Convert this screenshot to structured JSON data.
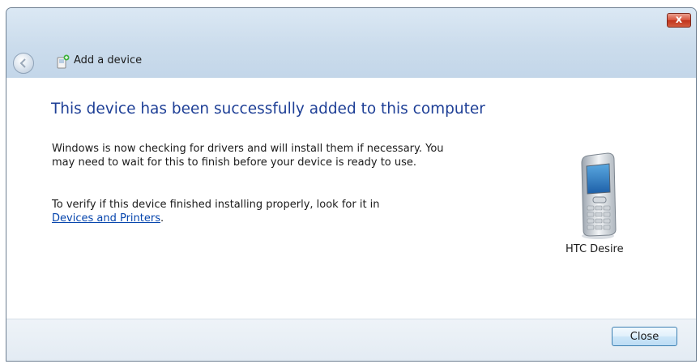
{
  "window": {
    "title": "Add a device",
    "close_glyph": "x"
  },
  "icons": {
    "back": "back-arrow-icon",
    "title": "add-device-icon",
    "close": "close-icon",
    "device": "mobile-phone-icon"
  },
  "content": {
    "headline": "This device has been successfully added to this computer",
    "paragraph1": "Windows is now checking for drivers and will install them if necessary. You may need to wait for this to finish before your device is ready to use.",
    "paragraph2": "To verify if this device finished installing properly, look for it in",
    "link": "Devices and Printers",
    "link_suffix": ".",
    "device_name": "HTC Desire"
  },
  "footer": {
    "close_label": "Close"
  },
  "colors": {
    "headline": "#1e3f96",
    "link": "#0645ad",
    "titlebar": "#cbdcec"
  }
}
